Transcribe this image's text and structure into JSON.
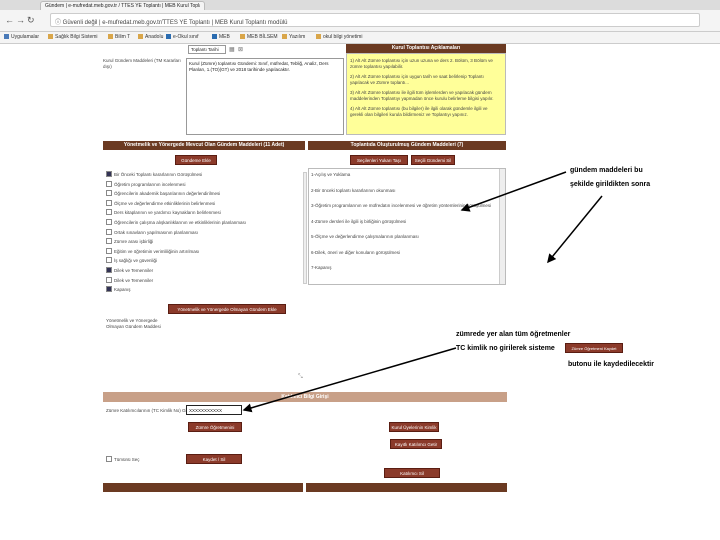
{
  "browser": {
    "tab_title": "Gündem | e-mufredat.meb.gov.tr / TTES YE Toplantı | MEB Kurul Toplantı modülü",
    "url": "ⓘ Güvenli değil | e-mufredat.meb.gov.tr/TTES YE Toplantı | MEB Kurul Toplantı modülü",
    "bookmarks": [
      "Uygulamalar",
      "Sağlık Bilgi Sistemi",
      "Bilim T",
      "Anadolu",
      "e-Okul sınıf",
      "MEB",
      "MEB BİLSEM",
      "Yazılım",
      "okul bilgi yönetimi"
    ]
  },
  "form": {
    "title_field": "Toplantı Tarihi",
    "agenda_label": "Kurul Gündem Maddeleri (TM Kararları dışı)",
    "agenda_text": "Kurul (Zümre) toplantısı Gündemi: Sınıf, müfredat, Tebliğ, Analiz, Ders Planları, 1.(TO)(GT) ve 2018 tarihinde yapılacaktır.",
    "info_header": "Kurul Toplantısı Açıklamaları",
    "info_lines": [
      "1) Alt Alt Zümre toplantısı için uzun uzuna ve ders 2. Bölüm, 3 Bölüm ve zümre toplantısı yapılabilir.",
      "2) Alt Alt Zümre toplantısı için uygun tarih ve saat belirlenip Toplantı yapılacak ve Zümre toplantı...",
      "3) Alt Alt Zümre toplantısı ile ilgili tüm işlemlerden ve yapılacak gündem maddelerinden Toplantıyı yapmadan önce kurulu belirleme bilgisi yapılır.",
      "4) Alt Alt Zümre toplantısı (bu bilgiler) ile ilgili olarak gündemle ilgili ve gerekli olan bilgileri kurula bildirmeniz ve Toplantıyı yapınız."
    ]
  },
  "mevcut": {
    "header": "Yönetmelik ve Yönergede Mevcut Olan Gündem Maddeleri (11 Adet)",
    "button": "Gündeme Ekle",
    "items": [
      {
        "label": "Bir Önceki Toplantı kararlarının Görüşülmesi",
        "checked": true
      },
      {
        "label": "Öğretim programlarının incelenmesi",
        "checked": false
      },
      {
        "label": "Öğrencilerin akademik başarılarının değerlendirilmesi",
        "checked": false
      },
      {
        "label": "Ölçme ve değerlendirme etkinliklerinin belirlenmesi",
        "checked": false
      },
      {
        "label": "Ders kitaplarının ve yardımcı kaynakların belirlenmesi",
        "checked": false
      },
      {
        "label": "Öğrencilerin çalışma alışkanlıklarının ve etkinliklerinin planlanması",
        "checked": false
      },
      {
        "label": "Ortak sınavların yapılmasının planlanması",
        "checked": false
      },
      {
        "label": "Zümre arası işbirliği",
        "checked": false
      },
      {
        "label": "Eğitim ve öğretimin verimliliğinin artırılması",
        "checked": false
      },
      {
        "label": "İş sağlığı ve güvenliği",
        "checked": false
      },
      {
        "label": "Dilek ve Temenniler",
        "checked": true
      },
      {
        "label": "Dilek ve Temenniler",
        "checked": false
      },
      {
        "label": "Kapanış",
        "checked": true
      }
    ]
  },
  "olusturulan": {
    "header": "Toplantıda Oluşturulmuş Gündem Maddeleri (7)",
    "btn_up": "Seçilenleri Yukarı Taşı",
    "btn_del": "Seçili Gündemi Sil",
    "items": [
      "1-Açılış ve Yoklama",
      "2-Bir önceki toplantı kararlarının okunması",
      "3-Öğretim programlarının ve müfredatın incelenmesi ve öğretim yöntemlerinin görüşülmesi",
      "4-Zümre dersleri ile ilgili iş birliğinin görüşülmesi",
      "5-Ölçme ve değerlendirme çalışmalarının planlanması",
      "6-Dilek, öneri ve diğer konuların görüşülmesi",
      "7-Kapanış"
    ]
  },
  "yonetmelik_btn": "Yönetmelik ve Yönergede Olmayan Gündem Ekle",
  "new_agenda_label": "Yönetmelik ve Yönergede Olmayan Gündem Maddesi",
  "katilimci": {
    "header": "Katılımcı Bilgi Girişi",
    "tc_label": "Zümre Katılımcılarının (TC Kimlik No) Giriniz",
    "tc_value": "XXXXXXXXXXX",
    "btn_add_teacher": "Zümre Öğretmenini Kaydet",
    "btn_teachers": "Kurul Üyelerinin Kimlik Kaydı",
    "btn_auto": "Kayıtlı Katılımcı Getir",
    "checkbox_label": "Tümünü Seç",
    "btn_kaydet": "Kaydet / Sil",
    "btn_list": "Katılımcı Sil"
  },
  "annotations": {
    "note1_line1": "gündem maddeleri bu",
    "note1_line2": "şekilde girildikten sonra",
    "note2_line1": "zümrede yer alan tüm öğretmenler",
    "note2_line2": "TC kimlik no girilerek sisteme",
    "note2_btn": "Zümre Öğretmeni Kaydet",
    "note2_line3": "butonu ile kaydedilecektir"
  }
}
